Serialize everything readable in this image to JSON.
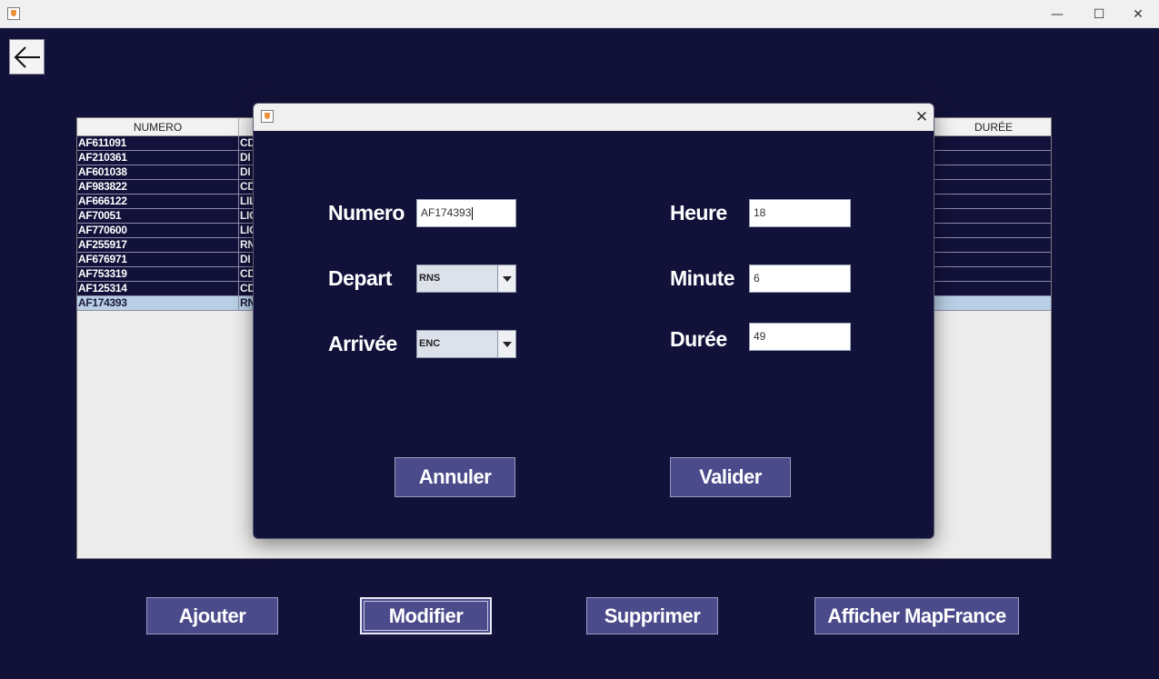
{
  "window": {
    "minimize_glyph": "—",
    "maximize_glyph": "☐",
    "close_glyph": "✕"
  },
  "back_button": {
    "icon": "arrow-left-icon"
  },
  "table": {
    "columns": [
      "NUMERO",
      "DURÉE"
    ],
    "rows": [
      {
        "numero": "AF611091",
        "depart": "CD"
      },
      {
        "numero": "AF210361",
        "depart": "DI"
      },
      {
        "numero": "AF601038",
        "depart": "DI"
      },
      {
        "numero": "AF983822",
        "depart": "CD"
      },
      {
        "numero": "AF666122",
        "depart": "LIL"
      },
      {
        "numero": "AF70051",
        "depart": "LIG"
      },
      {
        "numero": "AF770600",
        "depart": "LIG"
      },
      {
        "numero": "AF255917",
        "depart": "RN"
      },
      {
        "numero": "AF676971",
        "depart": "DI"
      },
      {
        "numero": "AF753319",
        "depart": "CD"
      },
      {
        "numero": "AF125314",
        "depart": "CD"
      },
      {
        "numero": "AF174393",
        "depart": "RN"
      }
    ],
    "selected_index": 11
  },
  "dialog": {
    "close_glyph": "✕",
    "labels": {
      "numero": "Numero",
      "depart": "Depart",
      "arrivee": "Arrivée",
      "heure": "Heure",
      "minute": "Minute",
      "duree": "Durée"
    },
    "fields": {
      "numero": "AF174393",
      "depart": "RNS",
      "arrivee": "ENC",
      "heure": "18",
      "minute": "6",
      "duree": "49"
    },
    "buttons": {
      "cancel": "Annuler",
      "validate": "Valider"
    }
  },
  "bottom_buttons": {
    "add": "Ajouter",
    "modify": "Modifier",
    "delete": "Supprimer",
    "map": "Afficher MapFrance"
  },
  "colors": {
    "background": "#12113a",
    "button": "#4b4b8c",
    "selected_row": "#b8cfe5"
  }
}
